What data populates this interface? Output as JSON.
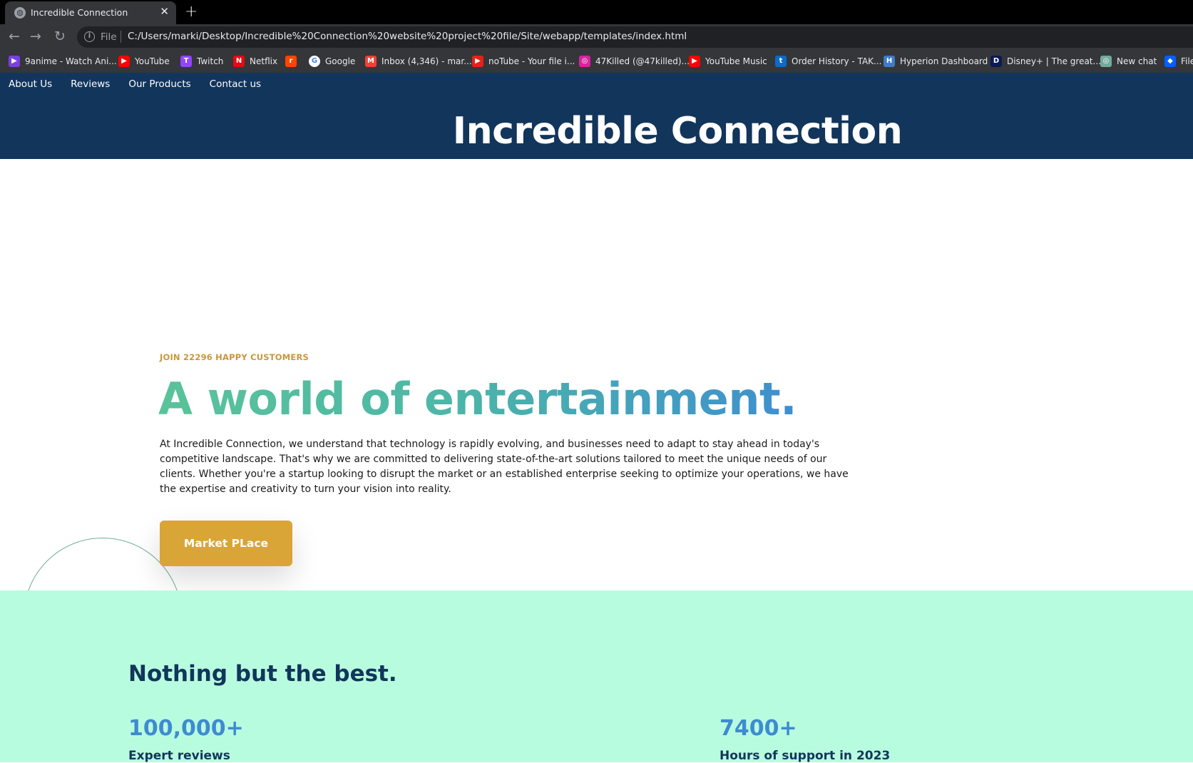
{
  "browser": {
    "tab_title": "Incredible Connection",
    "tab_close": "✕",
    "new_tab": "+",
    "scheme_label": "File",
    "url": "C:/Users/marki/Desktop/Incredible%20Connection%20website%20project%20file/Site/webapp/templates/index.html",
    "bookmarks": [
      {
        "label": "9anime - Watch Ani...",
        "color": "#7b3fe4",
        "glyph": "▶"
      },
      {
        "label": "YouTube",
        "color": "#ff0000",
        "glyph": "▶"
      },
      {
        "label": "Twitch",
        "color": "#9146ff",
        "glyph": "T"
      },
      {
        "label": "Netflix",
        "color": "#e50914",
        "glyph": "N"
      },
      {
        "label": "",
        "color": "#ff4500",
        "glyph": "r"
      },
      {
        "label": "Google",
        "color": "#ffffff",
        "glyph": "G"
      },
      {
        "label": "Inbox (4,346) - mar...",
        "color": "#ea4335",
        "glyph": "M"
      },
      {
        "label": "noTube - Your file i...",
        "color": "#e62117",
        "glyph": "▶"
      },
      {
        "label": "47Killed (@47killed)...",
        "color": "#d6249f",
        "glyph": "◎"
      },
      {
        "label": "YouTube Music",
        "color": "#ff0000",
        "glyph": "▶"
      },
      {
        "label": "Order History - TAK...",
        "color": "#0b6bcb",
        "glyph": "t"
      },
      {
        "label": "Hyperion Dashboard",
        "color": "#3e7cc9",
        "glyph": "H"
      },
      {
        "label": "Disney+ | The great...",
        "color": "#0b1a52",
        "glyph": "D"
      },
      {
        "label": "New chat",
        "color": "#74aa9c",
        "glyph": "◎"
      },
      {
        "label": "File",
        "color": "#0061fe",
        "glyph": "◆"
      }
    ]
  },
  "nav": {
    "items": [
      "About Us",
      "Reviews",
      "Our Products",
      "Contact us"
    ]
  },
  "header": {
    "title": "Incredible Connection"
  },
  "hero": {
    "eyebrow": "JOIN 22296 HAPPY CUSTOMERS",
    "headline": "A world of entertainment.",
    "intro": "At Incredible Connection, we understand that technology is rapidly evolving, and businesses need to adapt to stay ahead in today's competitive landscape. That's why we are committed to delivering state-of-the-art solutions tailored to meet the unique needs of our clients. Whether you're a startup looking to disrupt the market or an established enterprise seeking to optimize your operations, we have the expertise and creativity to turn your vision into reality.",
    "cta_label": "Market PLace"
  },
  "stats": {
    "title": "Nothing but the best.",
    "items": [
      {
        "value": "100,000+",
        "label": "Expert reviews"
      },
      {
        "value": "7400+",
        "label": "Hours of support in 2023"
      }
    ]
  },
  "colors": {
    "header_bg": "#12355b",
    "accent_gold": "#d9a536",
    "stats_bg": "#b8fce0",
    "stat_blue": "#3f8bd0"
  }
}
